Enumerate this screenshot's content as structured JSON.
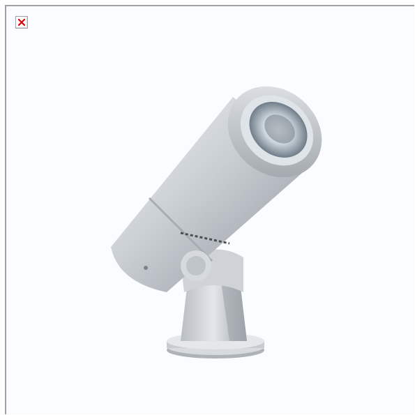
{
  "image": {
    "broken_icon": "broken-image-icon",
    "subject": "spotlight-fixture-image",
    "colors": {
      "frame_border": "#a0a0a0",
      "background": "#fafcff",
      "broken_x": "#e00000"
    }
  }
}
